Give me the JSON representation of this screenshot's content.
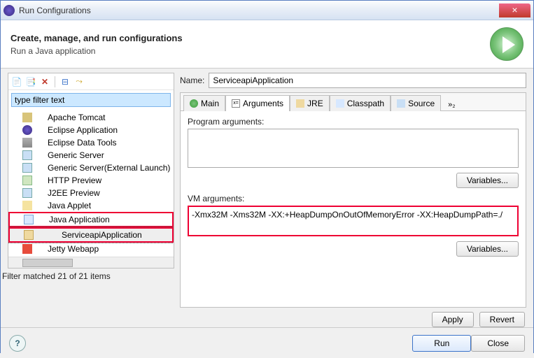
{
  "window": {
    "title": "Run Configurations",
    "close_label": "×"
  },
  "header": {
    "title": "Create, manage, and run configurations",
    "subtitle": "Run a Java application"
  },
  "left": {
    "filter_placeholder": "type filter text",
    "tree": [
      {
        "label": "Apache Tomcat",
        "icon": "ti-tomcat"
      },
      {
        "label": "Eclipse Application",
        "icon": "ti-eclipse"
      },
      {
        "label": "Eclipse Data Tools",
        "icon": "ti-db"
      },
      {
        "label": "Generic Server",
        "icon": "ti-srv"
      },
      {
        "label": "Generic Server(External Launch)",
        "icon": "ti-srv"
      },
      {
        "label": "HTTP Preview",
        "icon": "ti-http"
      },
      {
        "label": "J2EE Preview",
        "icon": "ti-j2ee"
      },
      {
        "label": "Java Applet",
        "icon": "ti-applet"
      },
      {
        "label": "Java Application",
        "icon": "ti-java",
        "expanded": true
      },
      {
        "label": "ServiceapiApplication",
        "icon": "ti-jar",
        "depth": 2,
        "selected": true
      },
      {
        "label": "Jetty Webapp",
        "icon": "ti-jetty"
      }
    ],
    "filter_status": "Filter matched 21 of 21 items"
  },
  "right": {
    "name_label": "Name:",
    "name_value": "ServiceapiApplication",
    "tabs": {
      "items": [
        {
          "label": "Main"
        },
        {
          "label": "Arguments",
          "active": true
        },
        {
          "label": "JRE"
        },
        {
          "label": "Classpath"
        },
        {
          "label": "Source"
        }
      ],
      "overflow": "»₂"
    },
    "program_args_label": "Program arguments:",
    "program_args_value": "",
    "vm_args_label": "VM arguments:",
    "vm_args_value": "-Xmx32M -Xms32M -XX:+HeapDumpOnOutOfMemoryError -XX:HeapDumpPath=./",
    "variables_label": "Variables...",
    "apply_label": "Apply",
    "revert_label": "Revert"
  },
  "footer": {
    "help": "?",
    "run": "Run",
    "close": "Close"
  }
}
